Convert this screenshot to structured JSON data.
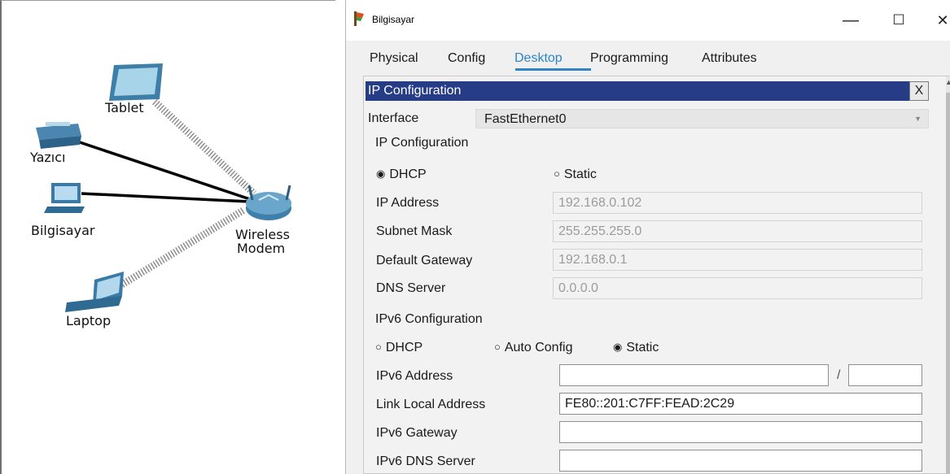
{
  "topology": {
    "nodes": {
      "tablet": "Tablet",
      "printer": "Yazıcı",
      "computer": "Bilgisayar",
      "modem_line1": "Wireless",
      "modem_line2": "Modem",
      "laptop": "Laptop"
    }
  },
  "window": {
    "title": "Bilgisayar",
    "controls": {
      "minimize": "—",
      "maximize": "☐",
      "close": "✕"
    }
  },
  "tabs": [
    "Physical",
    "Config",
    "Desktop",
    "Programming",
    "Attributes"
  ],
  "active_tab": "Desktop",
  "panel": {
    "header": "IP Configuration",
    "close": "X",
    "interface_label": "Interface",
    "interface_value": "FastEthernet0",
    "ipv4_section": "IP Configuration",
    "ipv4_modes": {
      "dhcp": "DHCP",
      "static": "Static",
      "selected": "DHCP"
    },
    "ip_address_label": "IP Address",
    "ip_address": "192.168.0.102",
    "subnet_label": "Subnet Mask",
    "subnet": "255.255.255.0",
    "gateway_label": "Default Gateway",
    "gateway": "192.168.0.1",
    "dns_label": "DNS Server",
    "dns": "0.0.0.0",
    "ipv6_section": "IPv6 Configuration",
    "ipv6_modes": {
      "dhcp": "DHCP",
      "auto": "Auto Config",
      "static": "Static",
      "selected": "Static"
    },
    "ipv6_address_label": "IPv6 Address",
    "ipv6_address": "",
    "ipv6_prefix": "",
    "ipv6_slash": "/",
    "link_local_label": "Link Local Address",
    "link_local": "FE80::201:C7FF:FEAD:2C29",
    "ipv6_gateway_label": "IPv6 Gateway",
    "ipv6_gateway": "",
    "ipv6_dns_label": "IPv6 DNS Server",
    "ipv6_dns": ""
  },
  "radio_symbols": {
    "on": "◉",
    "off": "○"
  },
  "colors": {
    "header_bg": "#273c87",
    "active_tab": "#2e84c7",
    "disabled_text": "#9b9b9b"
  }
}
